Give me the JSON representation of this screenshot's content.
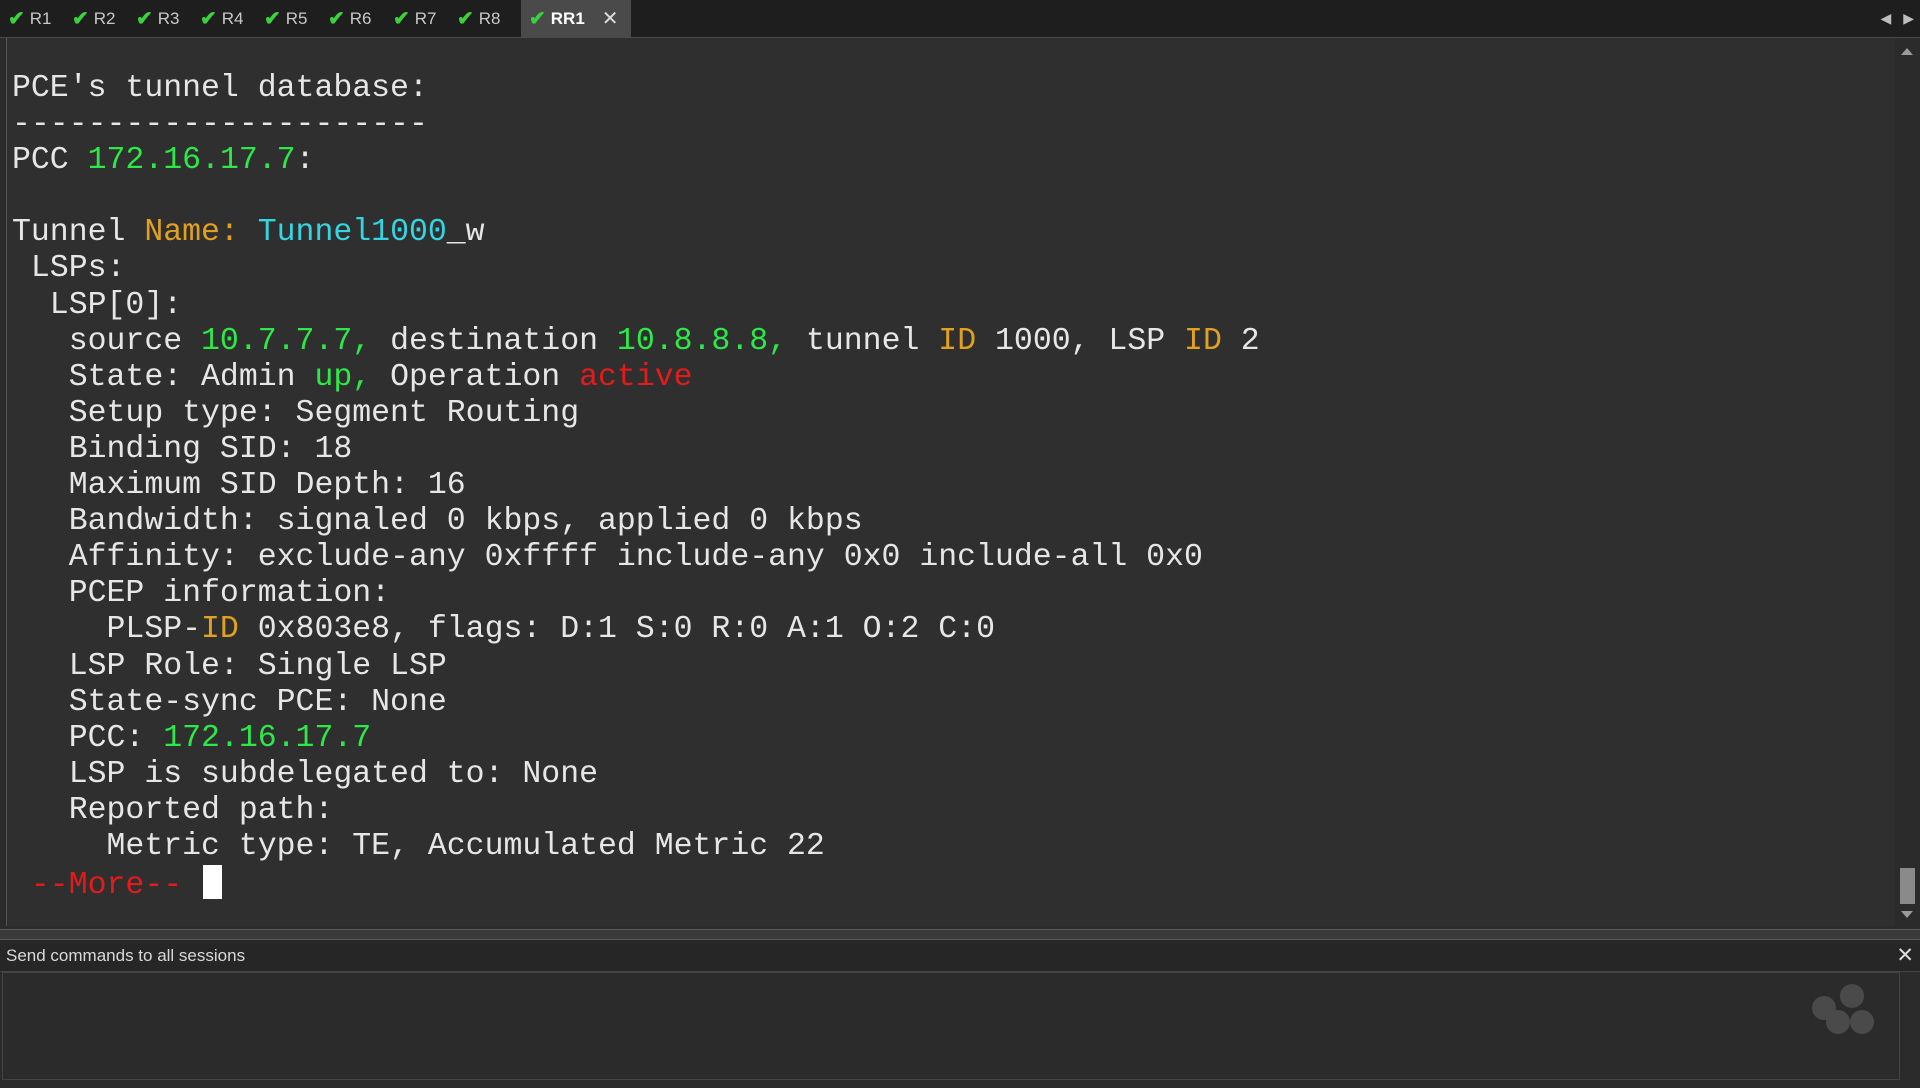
{
  "tabs": [
    {
      "label": "R1",
      "status": "connected"
    },
    {
      "label": "R2",
      "status": "connected"
    },
    {
      "label": "R3",
      "status": "connected"
    },
    {
      "label": "R4",
      "status": "connected"
    },
    {
      "label": "R5",
      "status": "connected"
    },
    {
      "label": "R6",
      "status": "connected"
    },
    {
      "label": "R7",
      "status": "connected"
    },
    {
      "label": "R8",
      "status": "connected"
    },
    {
      "label": "RR1",
      "status": "connected",
      "active": true
    }
  ],
  "icons": {
    "tab_status": "check-icon",
    "tab_close": "close-icon",
    "tab_scroll_left": "chevron-left-icon",
    "tab_scroll_right": "chevron-right-icon"
  },
  "colors": {
    "terminal_bg": "#2f2f2f",
    "green": "#2ee84a",
    "orange": "#e0a020",
    "cyan": "#36d4e0",
    "red": "#e21b1b",
    "text": "#e6e6e6"
  },
  "terminal": {
    "lines": [
      [
        {
          "t": "PCE's tunnel database:"
        }
      ],
      [
        {
          "t": "----------------------"
        }
      ],
      [
        {
          "t": "PCC "
        },
        {
          "t": "172.16.17.7",
          "c": "g"
        },
        {
          "t": ":"
        }
      ],
      [
        {
          "t": ""
        }
      ],
      [
        {
          "t": "Tunnel "
        },
        {
          "t": "Name:",
          "c": "o"
        },
        {
          "t": " "
        },
        {
          "t": "Tunnel1000",
          "c": "c"
        },
        {
          "t": "_w"
        }
      ],
      [
        {
          "t": " LSPs:"
        }
      ],
      [
        {
          "t": "  LSP[0]:"
        }
      ],
      [
        {
          "t": "   source "
        },
        {
          "t": "10.7.7.7,",
          "c": "g"
        },
        {
          "t": " destination "
        },
        {
          "t": "10.8.8.8,",
          "c": "g"
        },
        {
          "t": " tunnel "
        },
        {
          "t": "ID",
          "c": "o"
        },
        {
          "t": " 1000, LSP "
        },
        {
          "t": "ID",
          "c": "o"
        },
        {
          "t": " 2"
        }
      ],
      [
        {
          "t": "   State: Admin "
        },
        {
          "t": "up,",
          "c": "g"
        },
        {
          "t": " Operation "
        },
        {
          "t": "active",
          "c": "r"
        }
      ],
      [
        {
          "t": "   Setup type: Segment Routing"
        }
      ],
      [
        {
          "t": "   Binding SID: 18"
        }
      ],
      [
        {
          "t": "   Maximum SID Depth: 16"
        }
      ],
      [
        {
          "t": "   Bandwidth: signaled 0 kbps, applied 0 kbps"
        }
      ],
      [
        {
          "t": "   Affinity: exclude-any 0xffff include-any 0x0 include-all 0x0"
        }
      ],
      [
        {
          "t": "   PCEP information:"
        }
      ],
      [
        {
          "t": "     PLSP-"
        },
        {
          "t": "ID",
          "c": "o"
        },
        {
          "t": " 0x803e8, flags: D:1 S:0 R:0 A:1 O:2 C:0"
        }
      ],
      [
        {
          "t": "   LSP Role: Single LSP"
        }
      ],
      [
        {
          "t": "   State-sync PCE: None"
        }
      ],
      [
        {
          "t": "   PCC: "
        },
        {
          "t": "172.16.17.7",
          "c": "g"
        }
      ],
      [
        {
          "t": "   LSP is subdelegated to: None"
        }
      ],
      [
        {
          "t": "   Reported path:"
        }
      ],
      [
        {
          "t": "     Metric type: TE, Accumulated Metric 22"
        }
      ],
      [
        {
          "t": " --More-- ",
          "c": "r"
        }
      ]
    ]
  },
  "send_bar": {
    "label": "Send commands to all sessions",
    "input_value": ""
  }
}
